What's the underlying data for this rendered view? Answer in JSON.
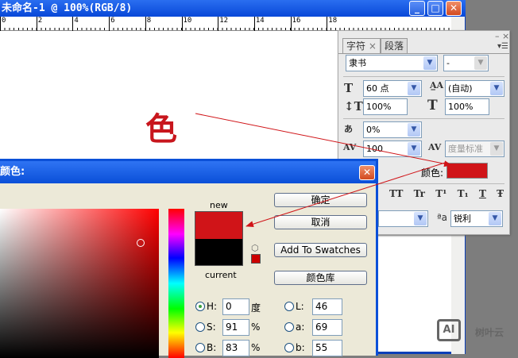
{
  "document": {
    "title": "未命名-1 @ 100%(RGB/8)",
    "ruler_ticks": [
      "0",
      "2",
      "4",
      "6",
      "8",
      "10",
      "12",
      "14",
      "16",
      "18"
    ],
    "canvas_text": "色"
  },
  "char_panel": {
    "tabs": [
      "字符",
      "段落"
    ],
    "tab_close": "×",
    "panel_min": "–",
    "panel_close": "×",
    "font_family": "隶书",
    "font_style": "-",
    "font_size": "60 点",
    "leading": "(自动)",
    "vertical_scale": "100%",
    "horizontal_scale": "100%",
    "baseline_shift": "0%",
    "tracking": "100",
    "kerning": "度量标准",
    "color_label": "颜色:",
    "color_value": "#d01418",
    "style_buttons": [
      "TT",
      "Tr",
      "T¹",
      "T₁",
      "T",
      "Ŧ"
    ],
    "aa_label": "ªa",
    "antialias": "锐利"
  },
  "color_picker": {
    "title": "颜色:",
    "new_label": "new",
    "current_label": "current",
    "new_color": "#d01418",
    "current_color": "#000000",
    "buttons": {
      "ok": "确定",
      "cancel": "取消",
      "add_swatches": "Add To Swatches",
      "libraries": "颜色库"
    },
    "fields": [
      {
        "label": "H:",
        "value": "0",
        "unit": "度",
        "selected": true
      },
      {
        "label": "S:",
        "value": "91",
        "unit": "%",
        "selected": false
      },
      {
        "label": "B:",
        "value": "83",
        "unit": "%",
        "selected": false
      },
      {
        "label": "L:",
        "value": "46",
        "selected": false
      },
      {
        "label": "a:",
        "value": "69",
        "selected": false
      },
      {
        "label": "b:",
        "value": "55",
        "selected": false
      }
    ]
  },
  "watermark": {
    "logo": "AI",
    "text": "树叶云"
  }
}
